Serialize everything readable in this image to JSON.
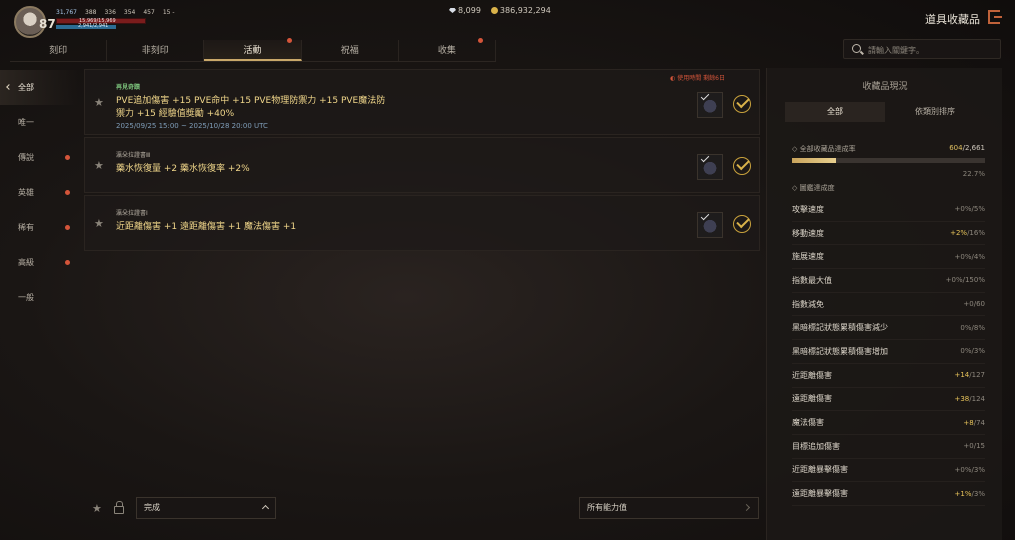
{
  "player": {
    "level": "87",
    "stats": [
      "31,767",
      "388",
      "336",
      "354",
      "457",
      "15 -"
    ],
    "hp": "15,969/15,969",
    "mp": "2,941/2,941"
  },
  "currency": {
    "gems": "8,099",
    "gold": "386,932,294"
  },
  "page_title": "道具收藏品",
  "tabs": [
    {
      "label": "刻印"
    },
    {
      "label": "非刻印"
    },
    {
      "label": "活動"
    },
    {
      "label": "祝福"
    },
    {
      "label": "收集"
    }
  ],
  "search": {
    "placeholder": "請輸入關鍵字。"
  },
  "sidebar": [
    {
      "label": "全部"
    },
    {
      "label": "唯一"
    },
    {
      "label": "傳說"
    },
    {
      "label": "英雄"
    },
    {
      "label": "稀有"
    },
    {
      "label": "高級"
    },
    {
      "label": "一般"
    }
  ],
  "rows": [
    {
      "category": "再見奇蹟",
      "effect_line1": "PVE追加傷害 +15 PVE命中 +15 PVE物理防禦力 +15 PVE魔法防",
      "effect_line2": "禦力 +15 經驗值獎勵 +40%",
      "period": "2025/09/25 15:00 ~ 2025/10/28 20:00 UTC",
      "timer": "使用時間 剩餘6日"
    },
    {
      "category": "瀛朵拉證書Ⅲ",
      "effect_line1": "藥水恢復量 +2 藥水恢復率 +2%"
    },
    {
      "category": "瀛朵拉證書Ⅰ",
      "effect_line1": "近距離傷害 +1 遠距離傷害 +1 魔法傷害 +1"
    }
  ],
  "bottom": {
    "status_filter": "完成",
    "ability_filter": "所有能力值"
  },
  "panel": {
    "title": "收藏品現況",
    "tabs": [
      {
        "label": "全部"
      },
      {
        "label": "依類別排序"
      }
    ],
    "overall_label": "全部收藏品達成率",
    "overall_current": "604",
    "overall_total": "/2,661",
    "overall_fraction": 0.227,
    "overall_pct": "22.7%",
    "section_label": "圖鑑達成度",
    "stats": [
      {
        "name": "攻擊速度",
        "cur": "+0%",
        "max": "/5%",
        "hi": false
      },
      {
        "name": "移動速度",
        "cur": "+2%",
        "max": "/16%",
        "hi": true
      },
      {
        "name": "施展速度",
        "cur": "+0%",
        "max": "/4%",
        "hi": false
      },
      {
        "name": "指數最大值",
        "cur": "+0%",
        "max": "/150%",
        "hi": false
      },
      {
        "name": "指數減免",
        "cur": "+0",
        "max": "/60",
        "hi": false
      },
      {
        "name": "黑暗標記狀態累積傷害減少",
        "cur": "0%",
        "max": "/8%",
        "hi": false
      },
      {
        "name": "黑暗標記狀態累積傷害增加",
        "cur": "0%",
        "max": "/3%",
        "hi": false
      },
      {
        "name": "近距離傷害",
        "cur": "+14",
        "max": "/127",
        "hi": true
      },
      {
        "name": "遠距離傷害",
        "cur": "+38",
        "max": "/124",
        "hi": true
      },
      {
        "name": "魔法傷害",
        "cur": "+8",
        "max": "/74",
        "hi": true
      },
      {
        "name": "目標追加傷害",
        "cur": "+0",
        "max": "/15",
        "hi": false
      },
      {
        "name": "近距離暴擊傷害",
        "cur": "+0%",
        "max": "/3%",
        "hi": false
      },
      {
        "name": "遠距離暴擊傷害",
        "cur": "+1%",
        "max": "/3%",
        "hi": true
      }
    ]
  },
  "colors": {
    "accent_gold": "#e8c45a",
    "alert_red": "#d4553a",
    "green_title": "#7ac07a"
  }
}
